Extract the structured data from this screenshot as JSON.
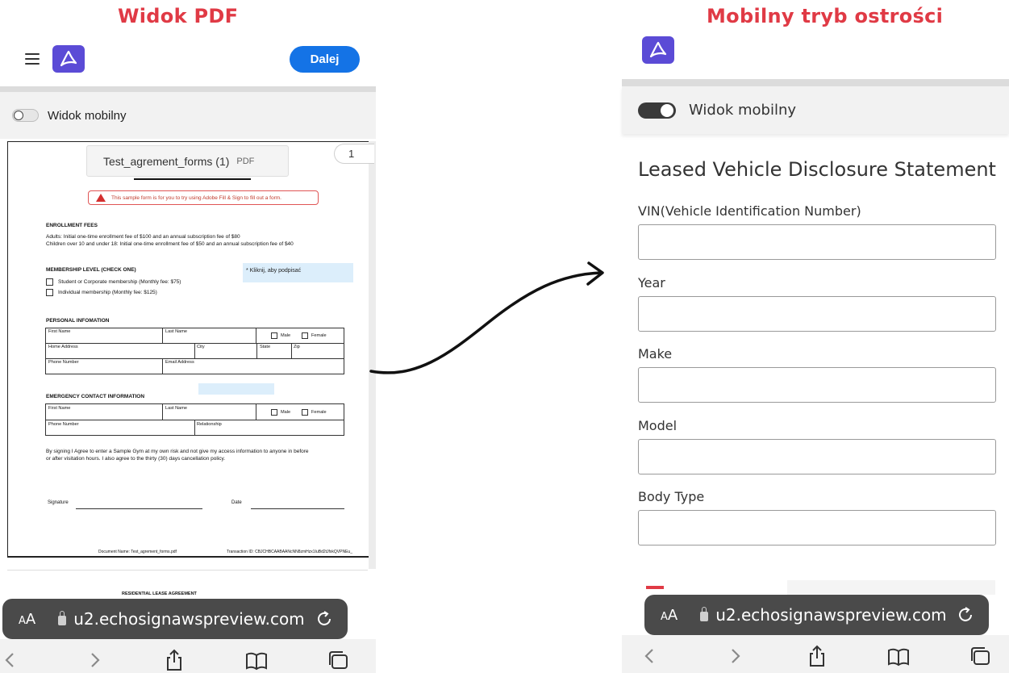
{
  "captions": {
    "left": "Widok PDF",
    "right": "Mobilny tryb ostrości"
  },
  "left_view": {
    "header": {
      "menu_icon": "hamburger-menu-icon",
      "logo_icon": "acrobat-logo-icon",
      "next_button": "Dalej"
    },
    "toggle": {
      "label": "Widok mobilny",
      "on": false
    },
    "file": {
      "name": "Test_agrement_forms (1)",
      "ext": "PDF",
      "page": "1"
    },
    "pdf": {
      "warning": "This sample form is for you to try using Adobe Fill & Sign to fill out a form.",
      "enrollment_title": "ENROLLMENT FEES",
      "enrollment_adults": "Adults: Initial one-time enrollment fee of $100 and an annual subscription fee of $80",
      "enrollment_children": "Children over 10 and under 18: Initial one-time enrollment fee of $50 and an annual subscription fee of $40",
      "membership_title": "MEMBERSHIP LEVEL (CHECK ONE)",
      "membership_opt1": "Student or Corporate membership (Monthly fee: $75)",
      "membership_opt2": "Individual membership (Monthly fee: $125)",
      "sign_hint": "* Kliknij, aby podpisać",
      "personal_title": "PERSONAL INFOMATION",
      "first_name": "First Name",
      "last_name": "Last Name",
      "male": "Male",
      "female": "Female",
      "home_address": "Home Address",
      "city": "City",
      "state": "State",
      "zip": "Zip",
      "phone_number": "Phone Number",
      "email_address": "Email Address",
      "emergency_title": "EMERGENCY CONTACT INFORMATION",
      "relationship": "Relationship",
      "agreement_line1": "By signing I Agree to enter a Sample Gym at my own risk and not give my access information to anyone in before",
      "agreement_line2": "or after visitation hours. I also agree to the thirty (30) days cancellation policy.",
      "signature": "Signature",
      "date": "Date",
      "doc_name": "Document Name: Test_agrement_forms.pdf",
      "transaction": "Transaction ID: CBJCHBCAABAANcNN8zmHzx1IuBd2tJfxkQVPNEu_",
      "next_page_title": "RESIDENTIAL LEASE AGREEMENT"
    },
    "browser": {
      "aa": "AA",
      "url": "u2.echosignawspreview.com"
    }
  },
  "right_view": {
    "header": {
      "logo_icon": "acrobat-logo-icon"
    },
    "toggle": {
      "label": "Widok mobilny",
      "on": true
    },
    "form_title": "Leased Vehicle Disclosure Statement",
    "fields": [
      {
        "label": "VIN(Vehicle Identification Number)",
        "value": ""
      },
      {
        "label": "Year",
        "value": ""
      },
      {
        "label": "Make",
        "value": ""
      },
      {
        "label": "Model",
        "value": ""
      },
      {
        "label": "Body Type",
        "value": ""
      }
    ],
    "browser": {
      "aa": "AA",
      "url": "u2.echosignawspreview.com"
    }
  },
  "toolbar_icons": [
    "back-icon",
    "forward-icon",
    "share-icon",
    "bookmarks-icon",
    "tabs-icon"
  ],
  "colors": {
    "caption_red": "#e03a45",
    "acrobat_purple": "#5b4bd6",
    "button_blue": "#1473e6",
    "url_bar": "#4a4a4a"
  }
}
